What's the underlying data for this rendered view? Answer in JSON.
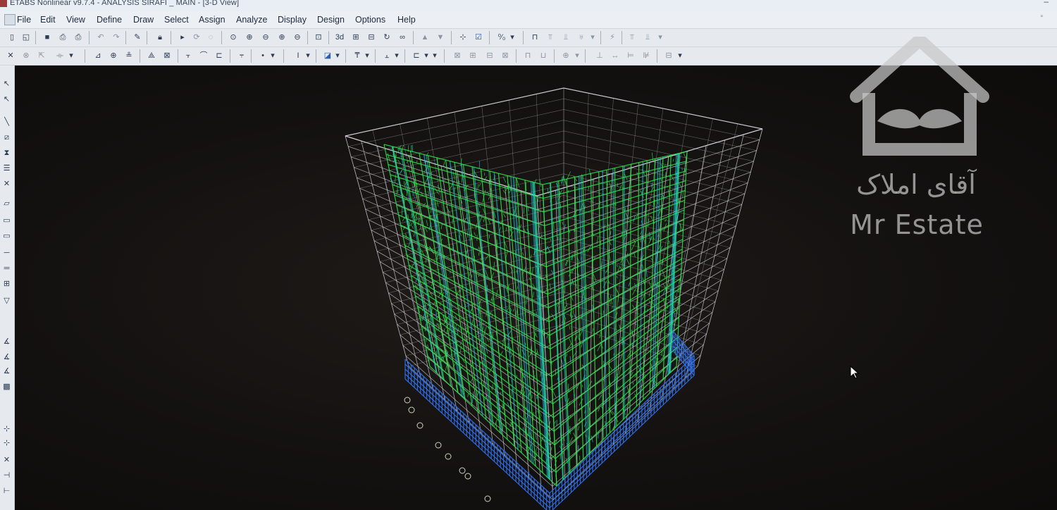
{
  "window": {
    "title": "ETABS Nonlinear v9.7.4 - ANALYSIS SIRAFI _ MAIN - [3-D View]",
    "minimize_glyph": "–",
    "restore_glyph": "▫"
  },
  "menu": [
    "File",
    "Edit",
    "View",
    "Define",
    "Draw",
    "Select",
    "Assign",
    "Analyze",
    "Display",
    "Design",
    "Options",
    "Help"
  ],
  "toolbar1": [
    "new-icon",
    "open-icon",
    "save-icon",
    "print-icon",
    "print-preview-icon",
    "undo-icon",
    "redo-icon",
    "pencil-icon",
    "lock-icon",
    "pointer-icon",
    "refresh-icon",
    "rubber-band-zoom-icon",
    "restore-view-icon",
    "zoom-in-icon",
    "zoom-out-icon",
    "pan-icon",
    "set-3d-view-icon",
    "3d-view-icon",
    "plan-view-icon",
    "elevation-view-icon",
    "rotate-3d-icon",
    "perspective-icon",
    "move-up-icon",
    "move-down-icon",
    "object-shrink-icon",
    "set-display-options-icon",
    "percent-icon",
    "show-undeformed-icon",
    "show-loads-icon",
    "show-deformed-icon",
    "show-mode-icon",
    "run-analysis-icon",
    "show-forces-icon",
    "show-stresses-icon"
  ],
  "toolbar1_labels": {
    "3d": "3d",
    "percent": "⁰⁄₀"
  },
  "toolbar2": [
    "select-all-icon",
    "get-previous-icon",
    "clear-selection-icon",
    "intersecting-line-icon",
    "draw-area-icon",
    "draw-rect-area-icon",
    "draw-line-icon",
    "draw-frame-icon",
    "draw-brace-icon",
    "draw-beam-icon",
    "draw-column-icon",
    "draw-point-icon",
    "draw-wall-icon",
    "assign-joint-icon",
    "assign-frame-icon",
    "assign-area-icon",
    "assign-load-icon",
    "assign-release-icon",
    "design-steel-icon",
    "design-concrete-icon",
    "design-composite-icon",
    "design-wall-icon",
    "show-grid-icon",
    "show-axes-icon",
    "show-dimension-icon",
    "snap-point-icon",
    "snap-line-icon",
    "snap-intersection-icon",
    "snap-perpendicular-icon",
    "snap-midpoint-icon"
  ],
  "lefttools": [
    "pointer-icon",
    "reshape-icon",
    "draw-line-icon",
    "draw-brace-icon",
    "draw-column-icon",
    "draw-wall-icon",
    "draw-cross-icon",
    "draw-area-icon",
    "draw-slab-icon",
    "draw-rect-area-icon",
    "draw-line-short-icon",
    "draw-line-long-icon",
    "draw-grid-icon",
    "draw-point-icon",
    "text-tool-icon",
    "label-tool-icon",
    "design-icon",
    "section-cut-icon",
    "snap-point-icon",
    "snap-intersection-icon",
    "snap-perpendicular-icon",
    "snap-midpoint-icon"
  ],
  "watermark": {
    "persian": "آقای املاک",
    "english": "Mr Estate"
  },
  "colors": {
    "background": "#141110",
    "grid": "#d8d8e0",
    "frame_green": "#2ee84a",
    "base_blue": "#2f6fe8",
    "cyan": "#22d0e0"
  }
}
